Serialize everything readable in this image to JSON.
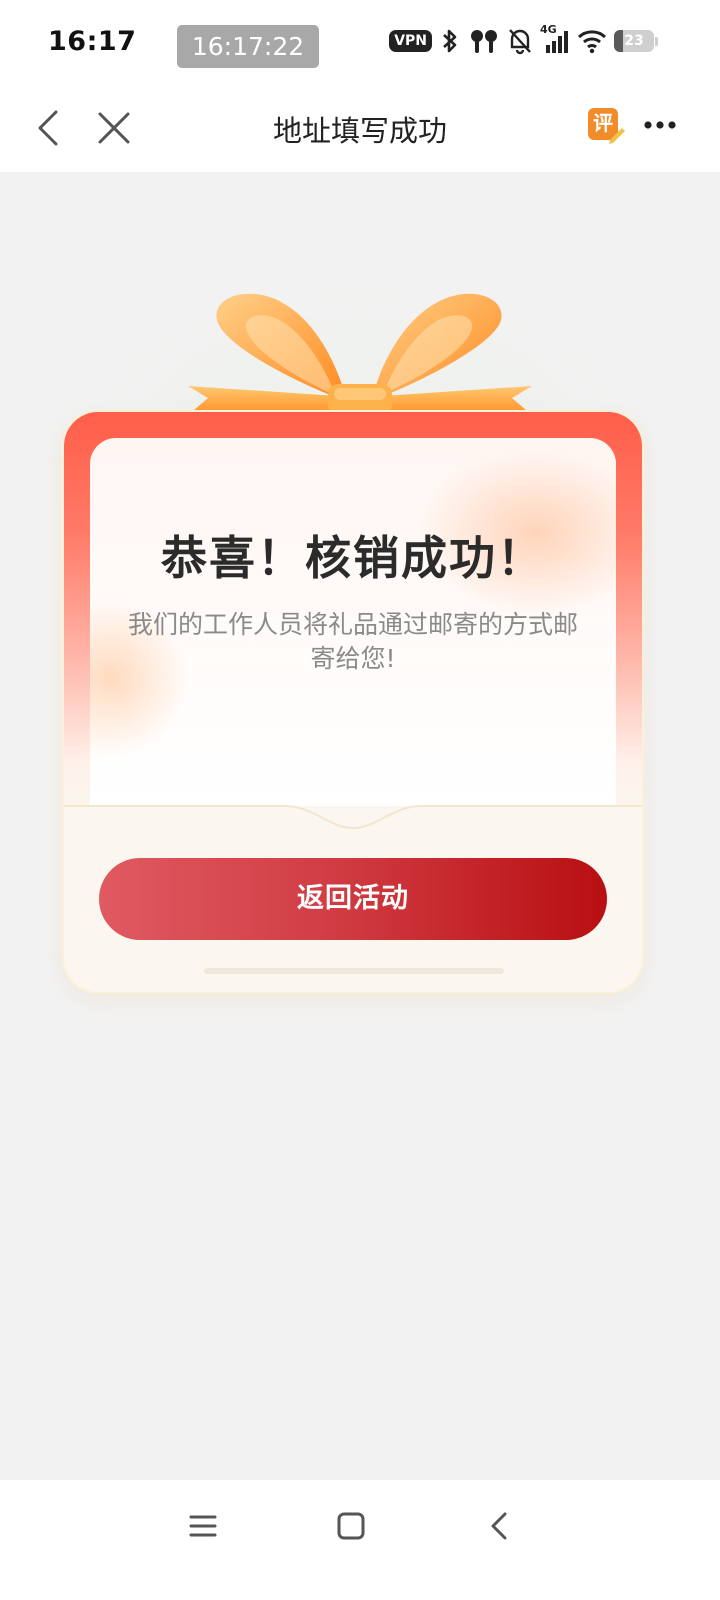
{
  "status_bar": {
    "time": "16:17",
    "clock_overlay": "16:17:22",
    "vpn_label": "VPN",
    "network_label": "4G",
    "battery_level": "23",
    "battery_fraction": 0.23,
    "icons": [
      "bluetooth-icon",
      "earbuds-icon",
      "mute-bell-icon",
      "signal-icon",
      "wifi-icon",
      "battery-icon"
    ]
  },
  "nav": {
    "title": "地址填写成功",
    "review_badge": "评",
    "accent_color": "#f08c2a"
  },
  "card": {
    "title": "恭喜！核销成功！",
    "message": "我们的工作人员将礼品通过邮寄的方式邮寄给您!",
    "button_label": "返回活动",
    "button_color": "#c8262b",
    "frame_color": "#ff5e4a",
    "ribbon_color": "#ffab40"
  },
  "system_nav": {
    "icons": [
      "menu-icon",
      "home-icon",
      "back-icon"
    ]
  }
}
